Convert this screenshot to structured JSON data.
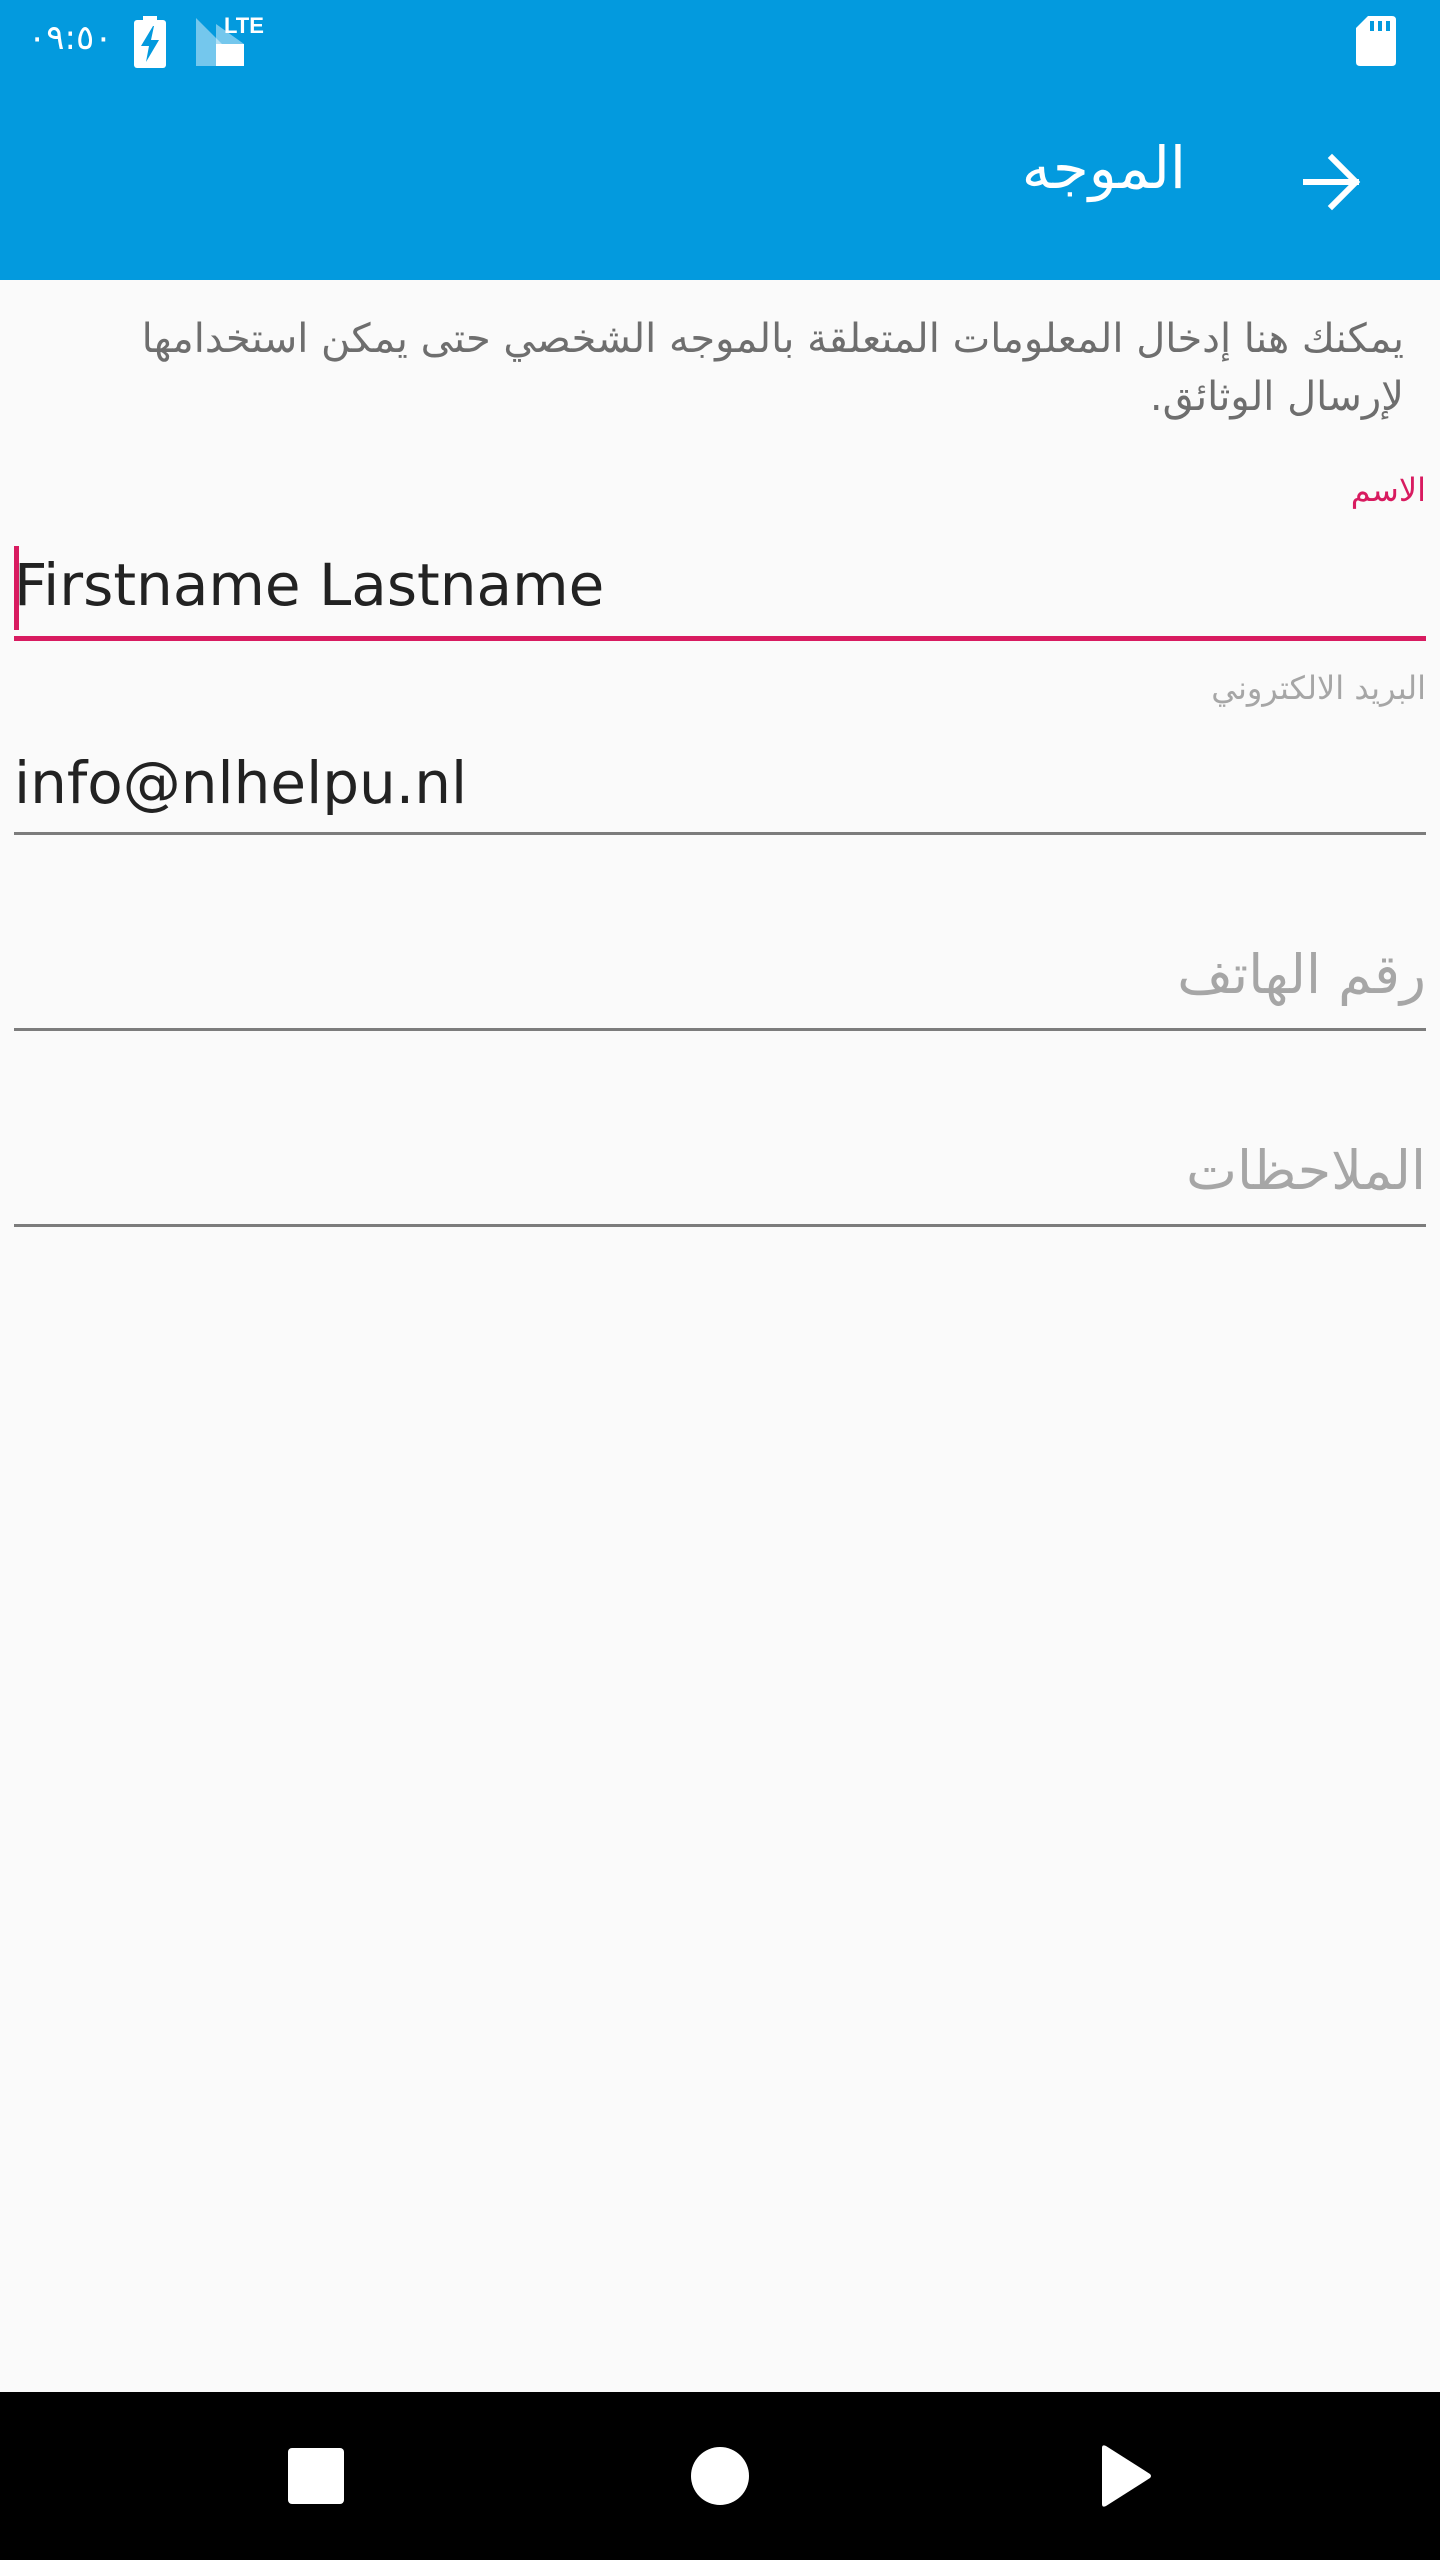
{
  "status_bar": {
    "time": "٠٩:٥٠",
    "network": "LTE",
    "icons": [
      "battery-charging-icon",
      "cell-signal-icon",
      "sd-card-icon"
    ]
  },
  "app_bar": {
    "title": "الموجه",
    "back_icon": "arrow-forward-icon"
  },
  "intro": {
    "text": "يمكنك هنا إدخال المعلومات المتعلقة بالموجه الشخصي حتى يمكن استخدامها لإرسال الوثائق."
  },
  "form": {
    "name": {
      "label": "الاسم",
      "value": "Firstname Lastname"
    },
    "email": {
      "label": "البريد الالكتروني",
      "value": "info@nlhelpu.nl"
    },
    "phone": {
      "placeholder": "رقم الهاتف",
      "value": ""
    },
    "notes": {
      "placeholder": "الملاحظات",
      "value": ""
    }
  },
  "nav_bar": {
    "icons": [
      "recents-square-icon",
      "home-circle-icon",
      "back-triangle-icon"
    ]
  },
  "colors": {
    "primary": "#039ade",
    "accent": "#d81b60",
    "background": "#fafafa",
    "hint": "#a6a6a6"
  }
}
